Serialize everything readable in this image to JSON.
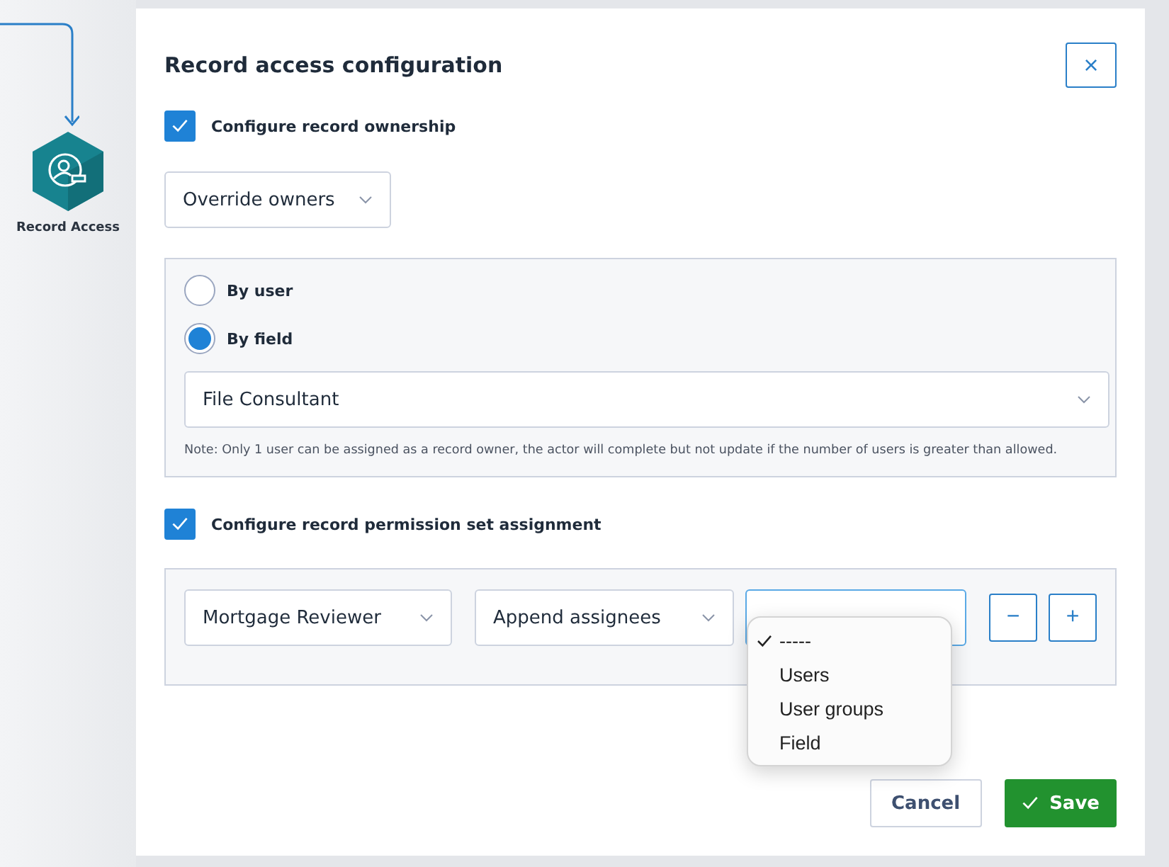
{
  "canvas": {
    "node": {
      "label": "Record Access"
    }
  },
  "dialog": {
    "title": "Record access configuration",
    "close": "×",
    "ownership": {
      "label": "Configure record ownership",
      "checked": true,
      "mode": "Override owners",
      "options": [
        {
          "label": "By user",
          "selected": false
        },
        {
          "label": "By field",
          "selected": true
        }
      ],
      "field": "File Consultant",
      "note": "Note: Only 1 user can be assigned as a record owner, the actor will complete but not update if the number of users is greater than allowed."
    },
    "permissions": {
      "label": "Configure record permission set assignment",
      "checked": true,
      "permission_set": "Mortgage Reviewer",
      "action": "Append assignees",
      "remove": "−",
      "add": "+",
      "menu": [
        {
          "label": "-----",
          "selected": true
        },
        {
          "label": "Users",
          "selected": false
        },
        {
          "label": "User groups",
          "selected": false
        },
        {
          "label": "Field",
          "selected": false
        }
      ]
    },
    "buttons": {
      "cancel": "Cancel",
      "save": "Save"
    }
  }
}
